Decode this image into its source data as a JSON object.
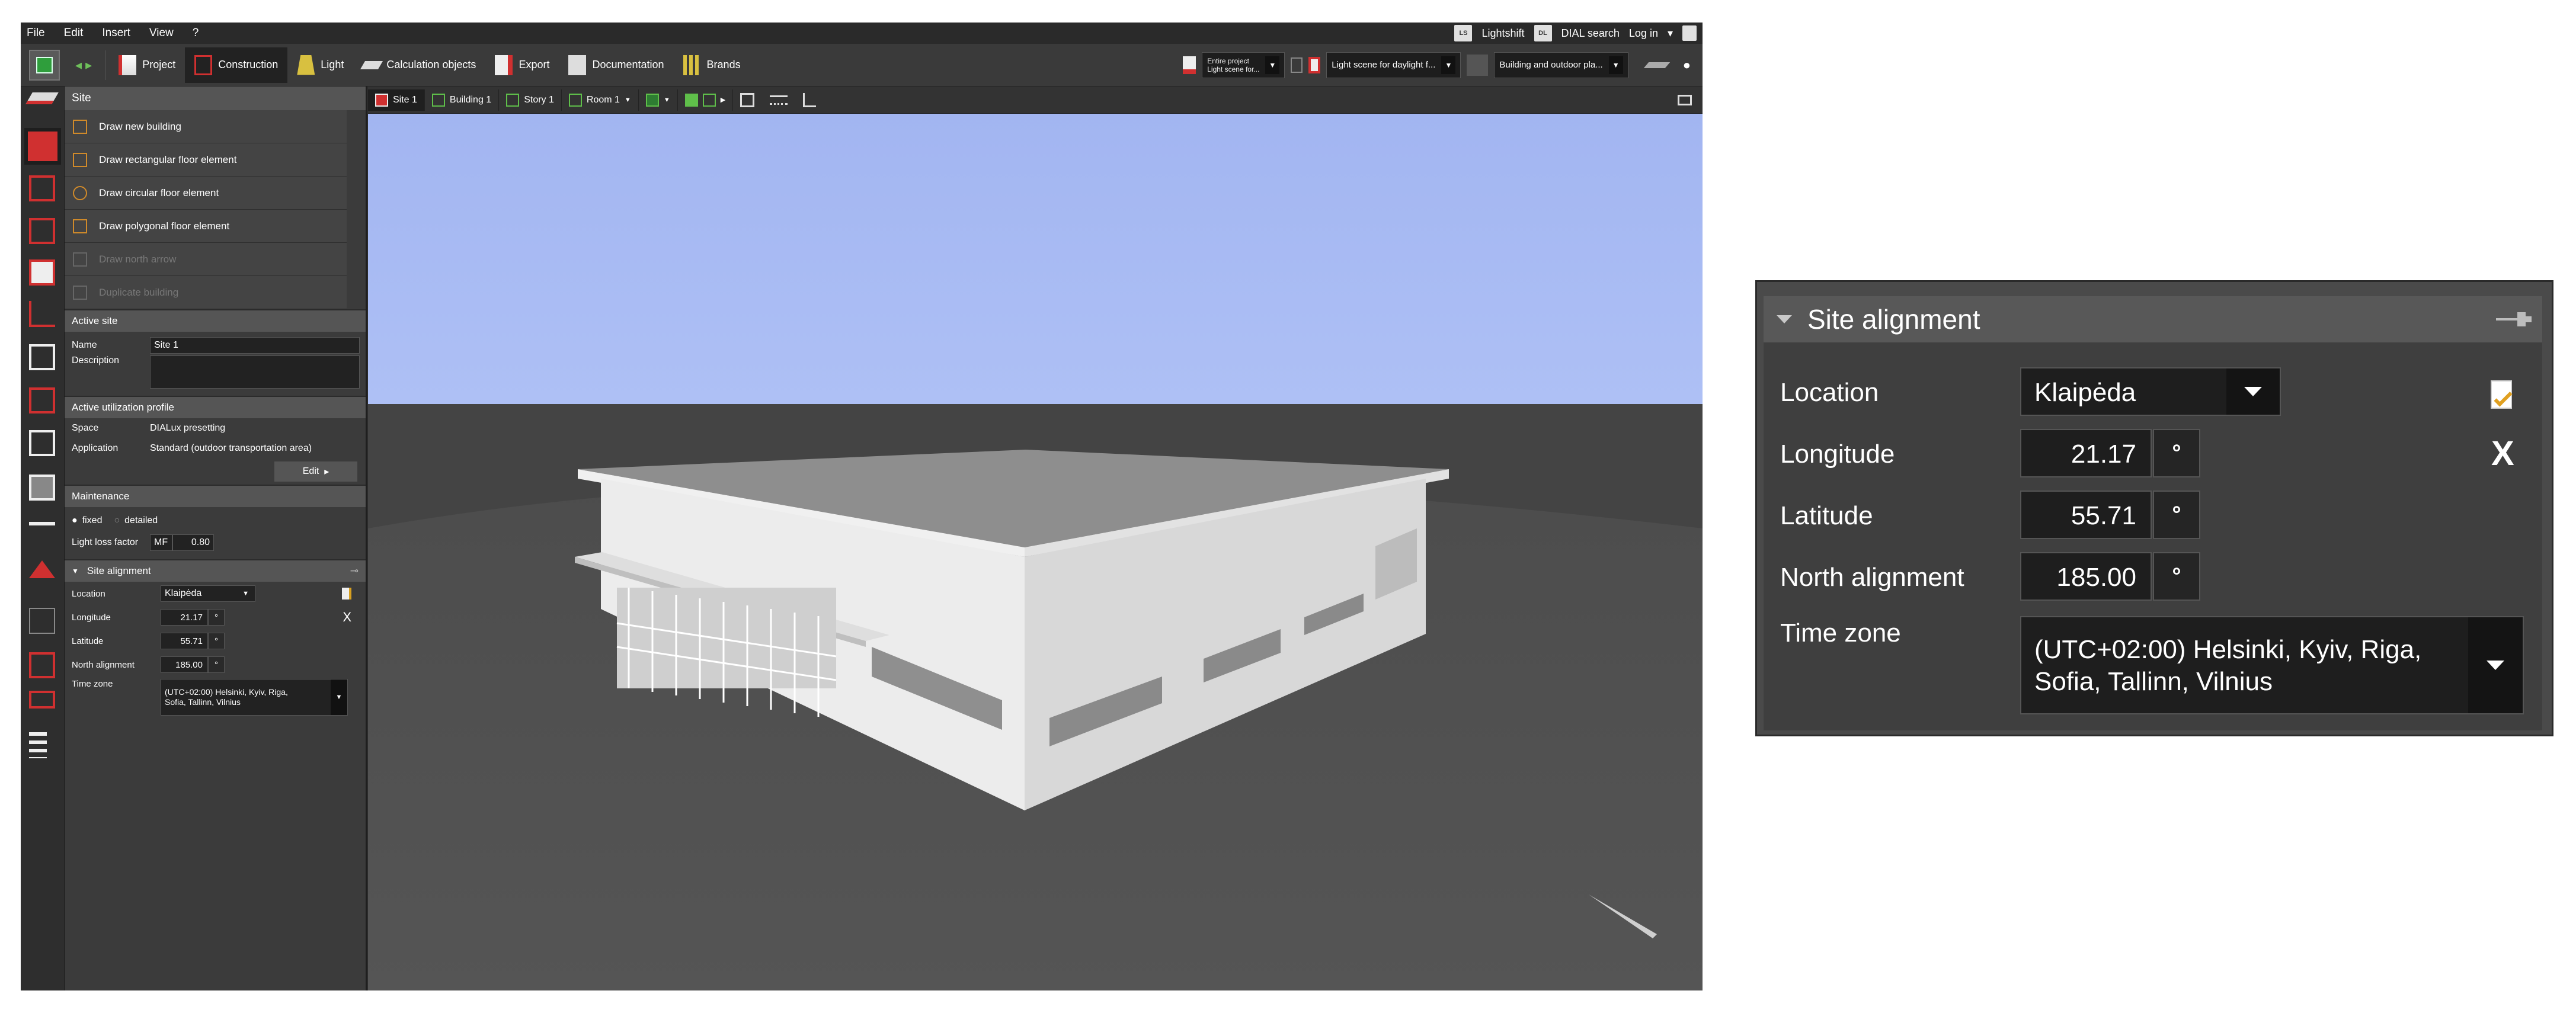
{
  "menu": [
    "File",
    "Edit",
    "Insert",
    "View",
    "?"
  ],
  "menu_right": {
    "lightshift": "Lightshift",
    "dialux_search": "DIAL search",
    "login": "Log in"
  },
  "toolbar": {
    "tabs": [
      "Project",
      "Construction",
      "Light",
      "Calculation objects",
      "Export",
      "Documentation",
      "Brands"
    ],
    "active_tab": "Construction",
    "scope_line1": "Entire project",
    "scope_line2": "Light scene for...",
    "light_scene": "Light scene for daylight f...",
    "view_mode": "Building and outdoor pla..."
  },
  "panel": {
    "site_header": "Site",
    "site_items": [
      "Draw new building",
      "Draw rectangular floor element",
      "Draw circular floor element",
      "Draw polygonal floor element",
      "Draw north arrow",
      "Duplicate building"
    ],
    "active_site_header": "Active site",
    "name_label": "Name",
    "name_value": "Site 1",
    "description_label": "Description",
    "utilization_header": "Active utilization profile",
    "space_label": "Space",
    "space_value": "DIALux presetting",
    "application_label": "Application",
    "application_value": "Standard (outdoor transportation area)",
    "edit_label": "Edit",
    "maintenance_header": "Maintenance",
    "fixed_label": "fixed",
    "detailed_label": "detailed",
    "llf_label": "Light loss factor",
    "llf_prefix": "MF",
    "llf_value": "0.80"
  },
  "viewport_tabs": [
    "Site 1",
    "Building 1",
    "Story 1",
    "Room 1"
  ],
  "site_alignment": {
    "title": "Site alignment",
    "location_label": "Location",
    "location_value": "Klaipėda",
    "longitude_label": "Longitude",
    "longitude_value": "21.17",
    "latitude_label": "Latitude",
    "latitude_value": "55.71",
    "north_label": "North alignment",
    "north_value": "185.00",
    "degree_symbol": "°",
    "timezone_label": "Time zone",
    "timezone_line1": "(UTC+02:00) Helsinki, Kyiv, Riga,",
    "timezone_line2": "Sofia, Tallinn, Vilnius",
    "close_glyph": "X"
  },
  "colors": {
    "sky_top": "#a3b6f2",
    "sky_bottom": "#acbef5",
    "ground": "#4d4d4d",
    "panel": "#3b3b3b",
    "accent_orange": "#d08a2a",
    "accent_green": "#5fbf4a"
  }
}
